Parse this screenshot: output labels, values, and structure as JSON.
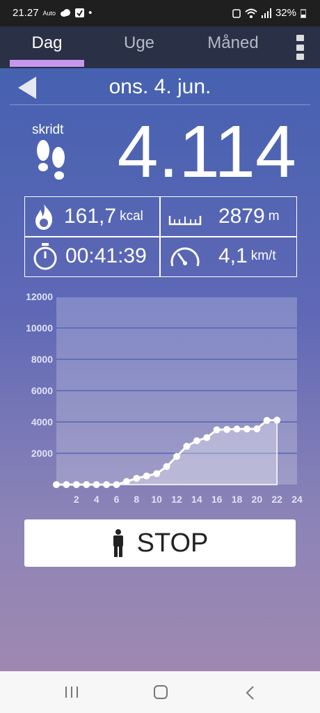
{
  "status": {
    "time": "21.27",
    "auto": "Auto",
    "dot": "•",
    "battery": "32%"
  },
  "tabs": [
    {
      "label": "Dag"
    },
    {
      "label": "Uge"
    },
    {
      "label": "Måned"
    }
  ],
  "date": "ons. 4. jun.",
  "steps": {
    "label": "skridt",
    "value": "4.114"
  },
  "stats": {
    "calories": {
      "value": "161,7",
      "unit": "kcal"
    },
    "distance": {
      "value": "2879",
      "unit": "m"
    },
    "duration": {
      "value": "00:41:39"
    },
    "speed": {
      "value": "4,1",
      "unit": "km/t"
    }
  },
  "stop_label": "STOP",
  "chart_data": {
    "type": "area",
    "y_ticks": [
      "2000",
      "4000",
      "6000",
      "8000",
      "10000",
      "12000"
    ],
    "x_ticks": [
      "2",
      "4",
      "6",
      "8",
      "10",
      "12",
      "14",
      "16",
      "18",
      "20",
      "22",
      "24"
    ],
    "ylim": [
      0,
      12000
    ],
    "xlim": [
      0,
      24
    ],
    "grid": true,
    "x": [
      0,
      1,
      2,
      3,
      4,
      5,
      6,
      7,
      8,
      9,
      10,
      11,
      12,
      13,
      14,
      15,
      16,
      17,
      18,
      19,
      20,
      21,
      22
    ],
    "values": [
      0,
      0,
      0,
      0,
      0,
      0,
      0,
      200,
      400,
      550,
      700,
      1150,
      1800,
      2450,
      2800,
      3000,
      3500,
      3520,
      3550,
      3550,
      3560,
      4100,
      4114
    ]
  }
}
